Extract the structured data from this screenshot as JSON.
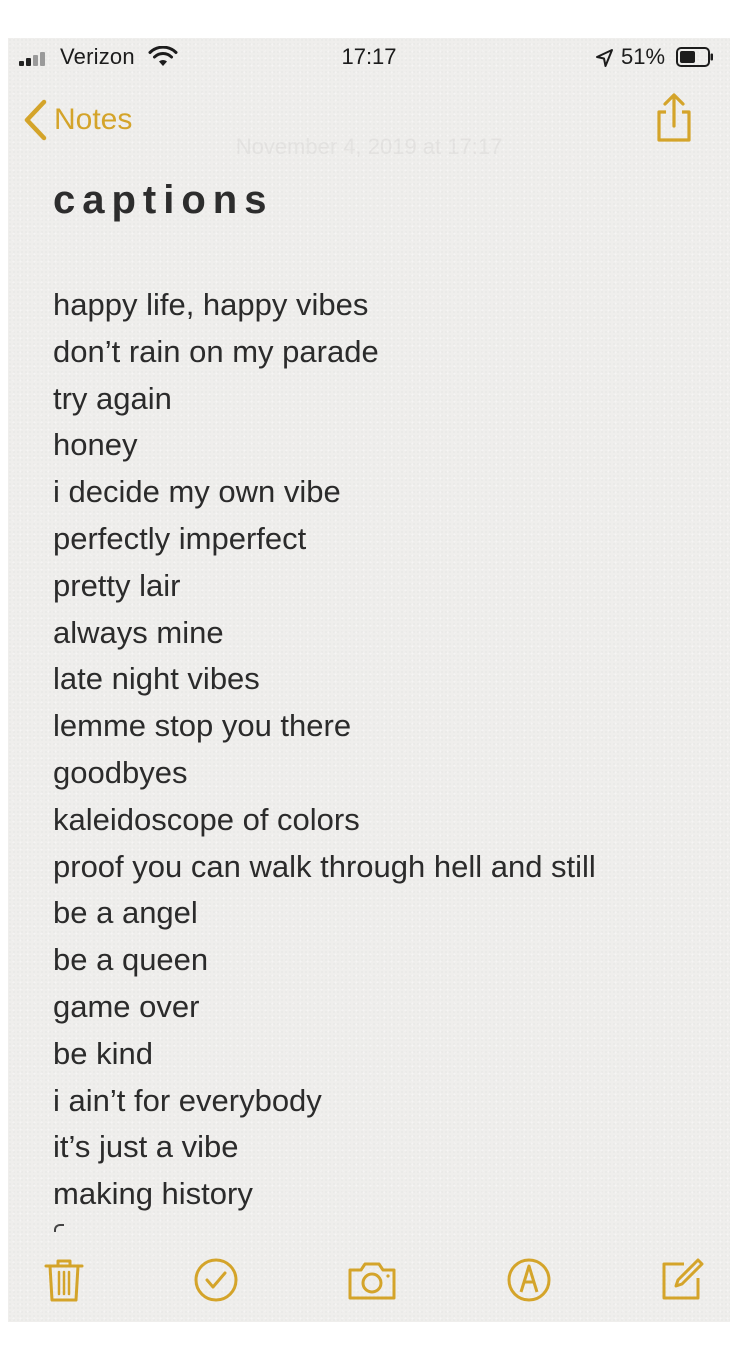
{
  "status_bar": {
    "carrier": "Verizon",
    "time": "17:17",
    "battery_percent": "51%"
  },
  "nav": {
    "back_label": "Notes",
    "note_date": "November 4, 2019 at 17:17"
  },
  "note": {
    "title": "captions",
    "lines": [
      "happy life, happy vibes",
      "don’t rain on my parade",
      "try again",
      "honey",
      "i decide my own vibe",
      "perfectly imperfect",
      "pretty lair",
      "always mine",
      "late night vibes",
      "lemme stop you there",
      "goodbyes",
      "kaleidoscope of colors",
      "proof you can walk through hell and still",
      "be a angel",
      "be a queen",
      "game over",
      "be kind",
      "i ain’t for everybody",
      "it’s just a vibe",
      "making history"
    ]
  },
  "toolbar": {
    "icons": [
      "trash-icon",
      "checklist-icon",
      "camera-icon",
      "markup-icon",
      "compose-icon"
    ]
  },
  "colors": {
    "accent": "#d4a42a",
    "paper": "#efeeec",
    "text": "#2b2b2b"
  }
}
